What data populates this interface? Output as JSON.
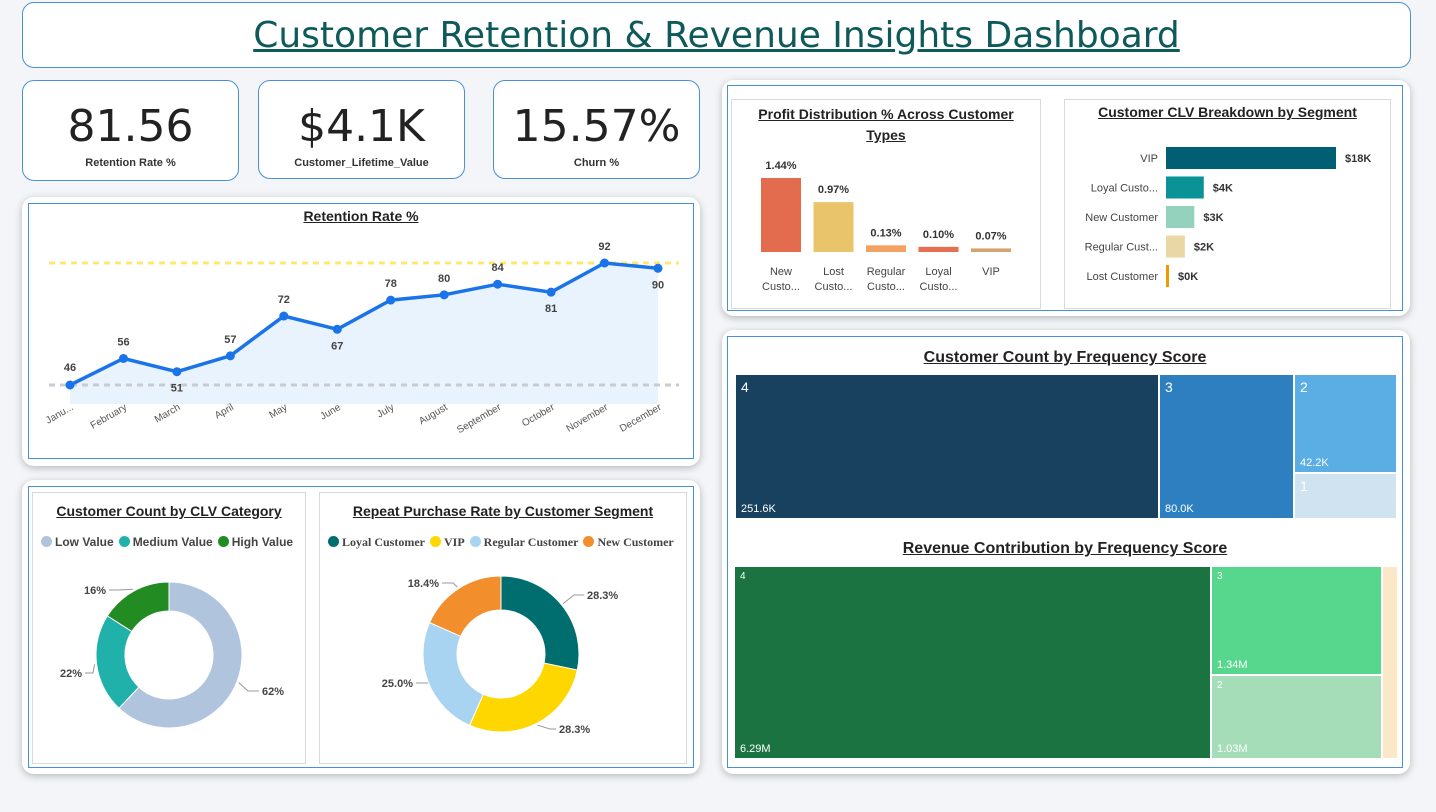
{
  "header": {
    "title": "Customer Retention & Revenue Insights Dashboard"
  },
  "kpis": [
    {
      "value": "81.56",
      "label": "Retention Rate %"
    },
    {
      "value": "$4.1K",
      "label": "Customer_Lifetime_Value"
    },
    {
      "value": "15.57%",
      "label": "Churn %"
    }
  ],
  "colors": {
    "line": "#1a73e8",
    "area": "#e8f3fd",
    "avg_line": "#ffe76b",
    "min_line": "#c8cbd0",
    "title_teal": "#0e5a5a",
    "frame_blue": "#4a90d9"
  },
  "chart_data": [
    {
      "id": "retention",
      "type": "area",
      "title": "Retention Rate %",
      "categories": [
        "January",
        "February",
        "March",
        "April",
        "May",
        "June",
        "July",
        "August",
        "September",
        "October",
        "November",
        "December"
      ],
      "tick_labels": [
        "Janu...",
        "February",
        "March",
        "April",
        "May",
        "June",
        "July",
        "August",
        "September",
        "October",
        "November",
        "December"
      ],
      "values": [
        46,
        56,
        51,
        57,
        72,
        67,
        78,
        80,
        84,
        81,
        92,
        90
      ],
      "reference_lines": [
        92,
        46
      ],
      "ylim": [
        40,
        100
      ],
      "grid": false
    },
    {
      "id": "profit",
      "type": "bar",
      "title": "Profit Distribution % Across Customer Types",
      "categories": [
        "New Custo...",
        "Lost Custo...",
        "Regular Custo...",
        "Loyal Custo...",
        "VIP"
      ],
      "tick_lines": [
        [
          "New",
          "Custo..."
        ],
        [
          "Lost",
          "Custo..."
        ],
        [
          "Regular",
          "Custo..."
        ],
        [
          "Loyal",
          "Custo..."
        ],
        [
          "VIP"
        ]
      ],
      "values": [
        1.44,
        0.97,
        0.13,
        0.1,
        0.07
      ],
      "value_labels": [
        "1.44%",
        "0.97%",
        "0.13%",
        "0.10%",
        "0.07%"
      ],
      "colors": [
        "#e46c4e",
        "#e9c46a",
        "#f4a261",
        "#e76f51",
        "#d4a373"
      ],
      "ylim": [
        0,
        1.6
      ]
    },
    {
      "id": "clv",
      "type": "bar",
      "orientation": "horizontal",
      "title": "Customer CLV Breakdown by Segment",
      "categories": [
        "VIP",
        "Loyal Custo...",
        "New Customer",
        "Regular Cust...",
        "Lost Customer"
      ],
      "values": [
        18,
        4,
        3,
        2,
        0
      ],
      "value_labels": [
        "$18K",
        "$4K",
        "$3K",
        "$2K",
        "$0K"
      ],
      "colors": [
        "#005f73",
        "#0a9396",
        "#94d2bd",
        "#e9d8a6",
        "#ee9b00"
      ],
      "xlim": [
        0,
        18
      ]
    },
    {
      "id": "clv_category",
      "type": "pie",
      "donut": true,
      "title": "Customer Count by CLV Category",
      "categories": [
        "Low Value",
        "Medium Value",
        "High Value"
      ],
      "values": [
        62,
        22,
        16
      ],
      "value_labels": [
        "62%",
        "22%",
        "16%"
      ],
      "colors": [
        "#b0c4de",
        "#20b2aa",
        "#228b22"
      ],
      "legend": "top"
    },
    {
      "id": "repeat_purchase",
      "type": "pie",
      "donut": true,
      "title": "Repeat Purchase Rate by Customer Segment",
      "categories": [
        "Loyal Customer",
        "VIP",
        "Regular Customer",
        "New Customer"
      ],
      "values": [
        28.3,
        28.3,
        25.0,
        18.4
      ],
      "value_labels": [
        "28.3%",
        "28.3%",
        "25.0%",
        "18.4%"
      ],
      "colors": [
        "#006d6f",
        "#ffd700",
        "#a8d4f2",
        "#f28e2b"
      ],
      "legend": "top"
    },
    {
      "id": "count_freq",
      "type": "treemap",
      "title": "Customer Count by Frequency Score",
      "categories": [
        "4",
        "3",
        "2",
        "1"
      ],
      "values": [
        251.6,
        80.0,
        42.2,
        19.4
      ],
      "value_labels": [
        "251.6K",
        "80.0K",
        "42.2K",
        ""
      ],
      "colors": [
        "#17415f",
        "#2e7fc0",
        "#5aaee3",
        "#cfe3f1"
      ]
    },
    {
      "id": "revenue_freq",
      "type": "treemap",
      "title": "Revenue Contribution by Frequency Score",
      "categories": [
        "4",
        "3",
        "2",
        ""
      ],
      "values": [
        6.29,
        1.34,
        1.03,
        0.09
      ],
      "value_labels": [
        "6.29M",
        "1.34M",
        "1.03M",
        ""
      ],
      "colors": [
        "#1a7340",
        "#57d68d",
        "#a5ddb8",
        "#fbe8c8"
      ]
    }
  ]
}
